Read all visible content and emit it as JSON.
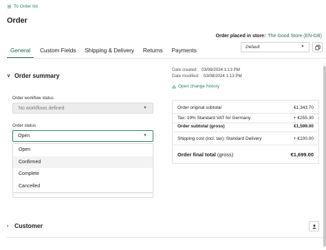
{
  "back_link": {
    "label": "To Order list"
  },
  "page": {
    "title": "Order"
  },
  "store": {
    "label": "Order placed in store:",
    "value": "The Good Store (EN-GB)"
  },
  "tabs": [
    {
      "label": "General",
      "active": true
    },
    {
      "label": "Custom Fields",
      "active": false
    },
    {
      "label": "Shipping & Delivery",
      "active": false
    },
    {
      "label": "Returns",
      "active": false
    },
    {
      "label": "Payments",
      "active": false
    }
  ],
  "language_select": {
    "value": "Default"
  },
  "order_summary": {
    "heading": "Order summary",
    "workflow": {
      "label": "Order workflow status",
      "value": "No workflows defined"
    },
    "status": {
      "label": "Order status",
      "value": "Open",
      "options": [
        "Open",
        "Confirmed",
        "Complete",
        "Cancelled"
      ]
    }
  },
  "meta": {
    "created_label": "Date created:",
    "created_value": "03/08/2024 1:13 PM",
    "modified_label": "Date modified:",
    "modified_value": "03/08/2024 1:13 PM",
    "history_link": "Open change history"
  },
  "totals": {
    "original_label": "Order original subtotal",
    "original_value": "€1,343.70",
    "tax_label": "Tax: 19% Standard VAT for Germany",
    "tax_value": "+ €255.30",
    "subtotal_label": "Order subtotal (gross)",
    "subtotal_value": "€1,599.00",
    "shipping_label": "Shipping cost (incl. tax): Standard Delivery",
    "shipping_value": "+ €100.00",
    "final_label": "Order final total",
    "final_suffix": " (gross)",
    "final_value": "€1,699.00"
  },
  "customer": {
    "heading": "Customer"
  },
  "colors": {
    "accent": "#2a7c68",
    "text": "#1d1d1f",
    "border": "#d7d7d7"
  },
  "icons": [
    "list-icon",
    "copy-icon",
    "history-icon",
    "chevron-down-icon",
    "chevron-right-icon",
    "user-icon"
  ]
}
